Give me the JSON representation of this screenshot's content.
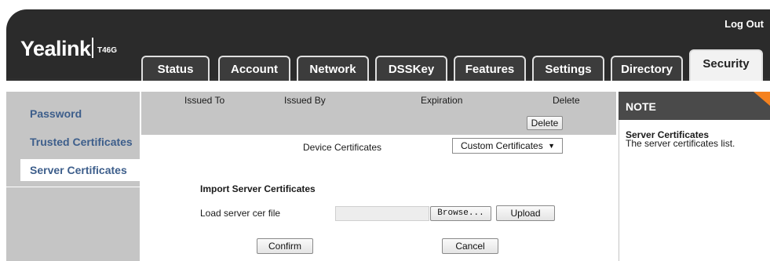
{
  "header": {
    "brand": "Yealink",
    "model": "T46G",
    "logout_label": "Log Out"
  },
  "tabs": [
    {
      "label": "Status"
    },
    {
      "label": "Account"
    },
    {
      "label": "Network"
    },
    {
      "label": "DSSKey"
    },
    {
      "label": "Features"
    },
    {
      "label": "Settings"
    },
    {
      "label": "Directory"
    },
    {
      "label": "Security",
      "active": true
    }
  ],
  "sidebar": {
    "items": [
      {
        "label": "Password"
      },
      {
        "label": "Trusted Certificates"
      },
      {
        "label": "Server Certificates",
        "selected": true
      }
    ]
  },
  "table": {
    "columns": [
      "Issued To",
      "Issued By",
      "Expiration",
      "Delete"
    ],
    "delete_button": "Delete"
  },
  "device_certificates": {
    "label": "Device Certificates",
    "selected_option": "Custom Certificates"
  },
  "import": {
    "heading": "Import Server Certificates",
    "load_label": "Load server cer file",
    "browse_button": "Browse...",
    "upload_button": "Upload"
  },
  "actions": {
    "confirm_button": "Confirm",
    "cancel_button": "Cancel"
  },
  "note": {
    "title": "NOTE",
    "subtitle": "Server Certificates",
    "description": "The server certificates list."
  },
  "colors": {
    "header_bg": "#2b2b2b",
    "sidebar_bg": "#c5c5c5",
    "link_color": "#3d5e8b",
    "note_accent": "#f5821f"
  }
}
